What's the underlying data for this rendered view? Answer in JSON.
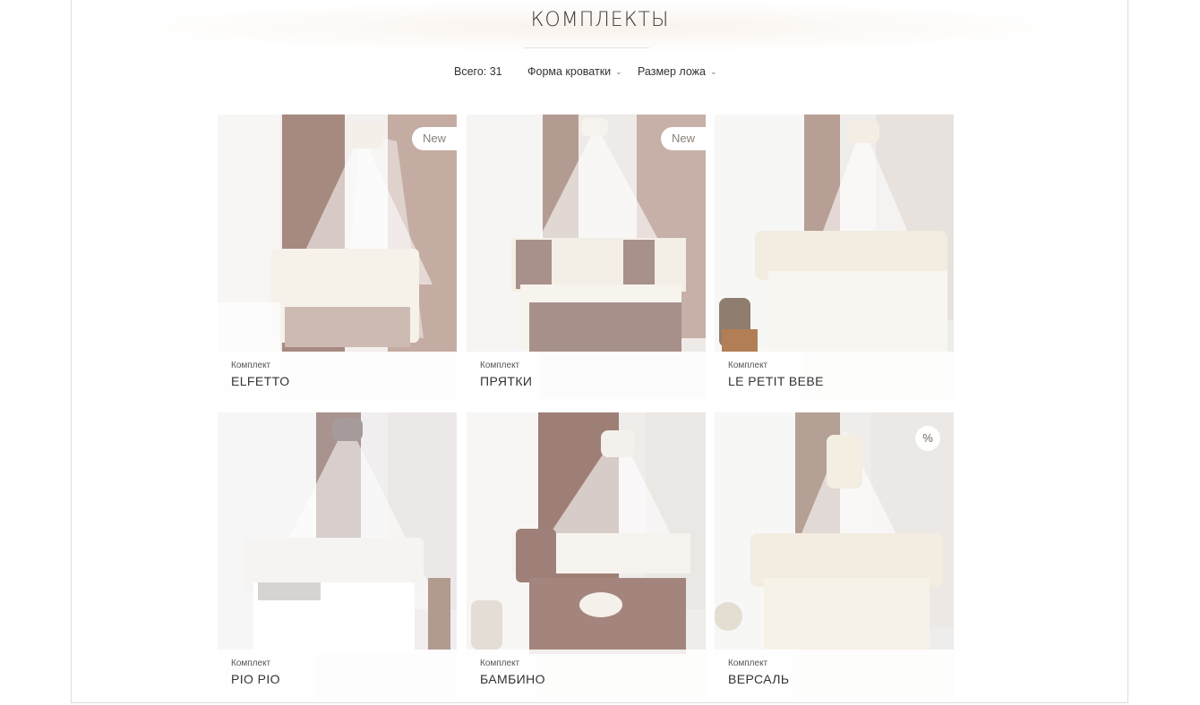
{
  "header": {
    "title": "КОМПЛЕКТЫ"
  },
  "filters": {
    "total": "Всего: 31",
    "crib_shape": "Форма кроватки",
    "mattress_size": "Размер ложа",
    "chevron": "chevron-down-icon"
  },
  "products": [
    {
      "kind": "Комплект",
      "name": "ELFETTO",
      "badge": "New"
    },
    {
      "kind": "Комплект",
      "name": "ПРЯТКИ",
      "badge": "New"
    },
    {
      "kind": "Комплект",
      "name": "LE PETIT BEBE",
      "badge": ""
    },
    {
      "kind": "Комплект",
      "name": "PIO PIO",
      "badge": ""
    },
    {
      "kind": "Комплект",
      "name": "БАМБИНО",
      "badge": ""
    },
    {
      "kind": "Комплект",
      "name": "ВЕРСАЛЬ",
      "badge": "%"
    }
  ],
  "colors": {
    "curtain_brown": "#a68a80",
    "canopy_white": "#f4f2f1",
    "bedding_taupe": "#a88e85",
    "cream": "#f3ece1"
  }
}
